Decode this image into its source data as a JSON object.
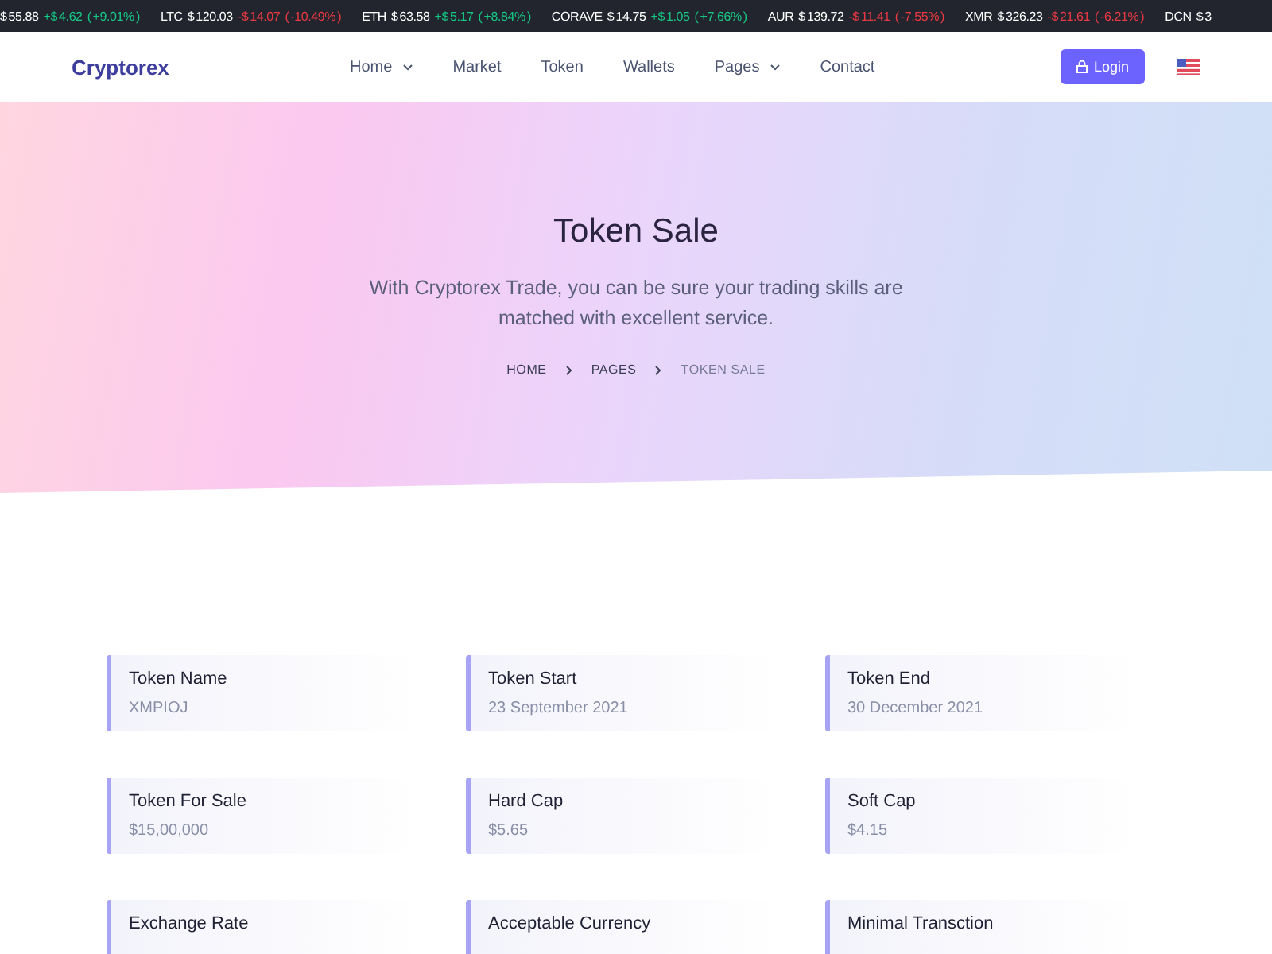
{
  "ticker": [
    {
      "price": "$ 55.88",
      "change": "+$ 4.62",
      "percent": "( +9.01% )",
      "color": "#16c784"
    },
    {
      "name": "LTC",
      "price": "$ 120.03",
      "change": "-$ 14.07",
      "percent": "( -10.49% )",
      "color": "#ea3943"
    },
    {
      "name": "ETH",
      "price": "$ 63.58",
      "change": "+$ 5.17",
      "percent": "( +8.84% )",
      "color": "#16c784"
    },
    {
      "name": "CORAVE",
      "price": "$ 14.75",
      "change": "+$ 1.05",
      "percent": "( +7.66% )",
      "color": "#16c784"
    },
    {
      "name": "AUR",
      "price": "$ 139.72",
      "change": "-$ 11.41",
      "percent": "( -7.55% )",
      "color": "#ea3943"
    },
    {
      "name": "XMR",
      "price": "$ 326.23",
      "change": "-$ 21.61",
      "percent": "( -6.21% )",
      "color": "#ea3943"
    },
    {
      "name": "DCN",
      "price": "$ 3"
    }
  ],
  "header": {
    "logo": "Cryptorex",
    "nav": [
      {
        "label": "Home",
        "has_menu": true
      },
      {
        "label": "Market",
        "has_menu": false
      },
      {
        "label": "Token",
        "has_menu": false
      },
      {
        "label": "Wallets",
        "has_menu": false
      },
      {
        "label": "Pages",
        "has_menu": true
      },
      {
        "label": "Contact",
        "has_menu": false
      }
    ],
    "login": "Login"
  },
  "hero": {
    "title": "Token Sale",
    "subtitle": "With Cryptorex Trade, you can be sure your trading skills are matched with excellent service.",
    "breadcrumb": [
      "HOME",
      "PAGES",
      "TOKEN SALE"
    ]
  },
  "details": [
    {
      "label": "Token Name",
      "value": "XMPIOJ"
    },
    {
      "label": "Token Start",
      "value": "23 September 2021"
    },
    {
      "label": "Token End",
      "value": "30 December 2021"
    },
    {
      "label": "Token For Sale",
      "value": "$15,00,000"
    },
    {
      "label": "Hard Cap",
      "value": "$5.65"
    },
    {
      "label": "Soft Cap",
      "value": "$4.15"
    },
    {
      "label": "Exchange Rate"
    },
    {
      "label": "Acceptable Currency"
    },
    {
      "label": "Minimal Transction"
    }
  ]
}
